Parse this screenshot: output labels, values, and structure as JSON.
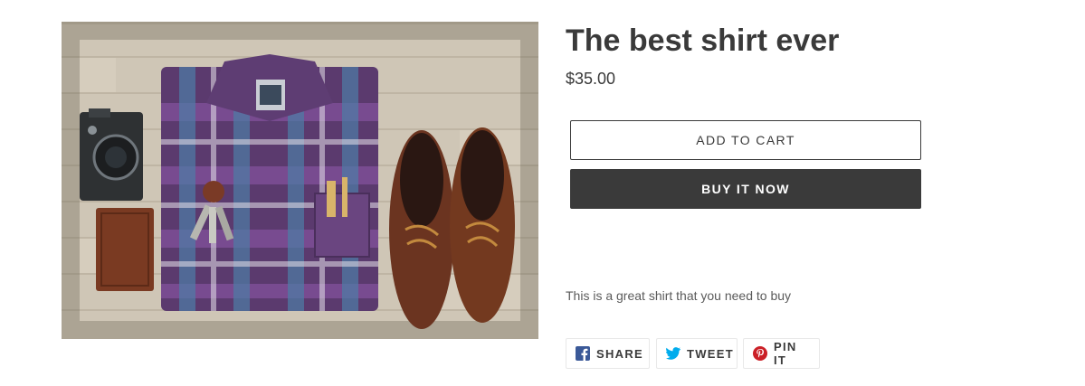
{
  "product": {
    "title": "The best shirt ever",
    "price": "$35.00",
    "description": "This is a great shirt that you need to buy",
    "image_alt": "Flat lay of plaid shirt, camera, wallet, keys and brown boat shoes"
  },
  "actions": {
    "add_to_cart": "ADD TO CART",
    "buy_now": "BUY IT NOW"
  },
  "share": {
    "facebook": "SHARE",
    "twitter": "TWEET",
    "pinterest": "PIN IT"
  },
  "colors": {
    "text": "#3a3a3a",
    "button_dark": "#3a3a3a",
    "facebook": "#3b5998",
    "twitter": "#00aced",
    "pinterest": "#cb2027"
  },
  "icons": [
    "facebook-icon",
    "twitter-icon",
    "pinterest-icon"
  ]
}
